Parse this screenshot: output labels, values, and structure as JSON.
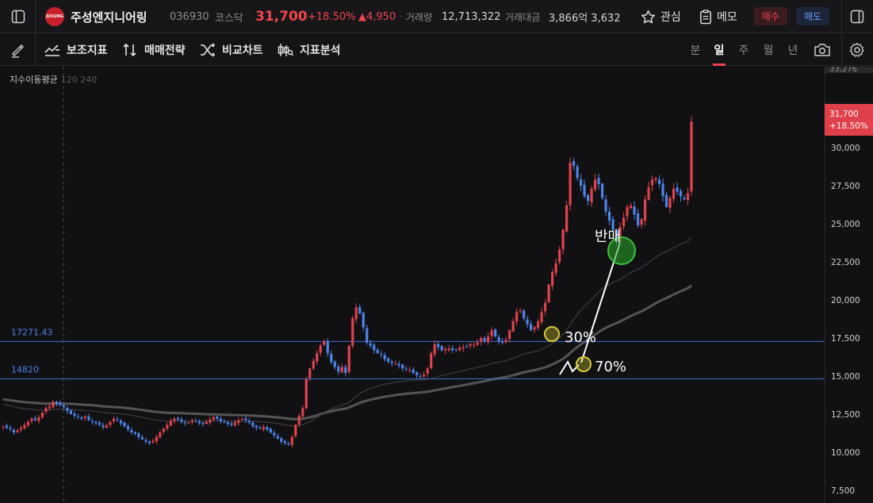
{
  "header": {
    "logo_text": "JUSUNG",
    "name": "주성엔지니어링",
    "code": "036930",
    "market": "코스닥",
    "sep": "·",
    "price": "31,700",
    "change_pct": "+18.50%",
    "change": "▲4,950",
    "volume_label": "거래량",
    "volume": "12,713,322",
    "amount_label": "거래대금",
    "amount": "3,866억 3,632",
    "watch_label": "관심",
    "memo_label": "메모",
    "buy_label": "매수",
    "sell_label": "매도"
  },
  "toolbar": {
    "tools": [
      "보조지표",
      "매매전략",
      "비교차트",
      "지표분석"
    ],
    "periods": [
      "분",
      "일",
      "주",
      "월",
      "년"
    ],
    "active_period": "일"
  },
  "chart": {
    "ma_label": "지수이동평균",
    "ma_dim": "120 240",
    "hlines": [
      {
        "value": 17271.43,
        "label": "17271.43"
      },
      {
        "value": 14820,
        "label": "14820"
      }
    ],
    "price_tag": {
      "price": "31,700",
      "pct": "+18.50%"
    },
    "top_tick": "33,276",
    "annotations": {
      "sell": "반매",
      "p30": "30%",
      "p70": "70%"
    }
  },
  "chart_data": {
    "type": "candlestick",
    "y_ticks": [
      "30,000",
      "27,500",
      "25,000",
      "22,500",
      "20,000",
      "17,500",
      "15,000",
      "12,500",
      "10,000",
      "7,500"
    ],
    "ylim": [
      7500,
      33276
    ],
    "closes": [
      11700,
      11600,
      11500,
      11300,
      11450,
      11600,
      11800,
      12000,
      12200,
      12100,
      12300,
      12600,
      12900,
      13000,
      13300,
      13200,
      13100,
      12950,
      12700,
      12500,
      12400,
      12300,
      12200,
      12350,
      12100,
      12000,
      11900,
      11800,
      11650,
      11750,
      12000,
      12200,
      12100,
      11900,
      11700,
      11500,
      11300,
      11200,
      11000,
      10850,
      10700,
      10600,
      10750,
      11000,
      11300,
      11550,
      11800,
      12050,
      12200,
      12150,
      12000,
      11900,
      11950,
      12100,
      12050,
      11900,
      11850,
      12000,
      12150,
      12300,
      12200,
      12050,
      11950,
      11850,
      11800,
      11950,
      12100,
      12200,
      12100,
      11950,
      11700,
      11600,
      11550,
      11650,
      11500,
      11300,
      11100,
      10900,
      10700,
      10600,
      10500,
      11000,
      11800,
      12400,
      12900,
      14800,
      15500,
      16000,
      16500,
      17000,
      17300,
      16500,
      15900,
      15600,
      15300,
      15600,
      15200,
      17000,
      18800,
      19500,
      19100,
      18200,
      17200,
      17000,
      16700,
      16500,
      16400,
      16100,
      15950,
      15850,
      15800,
      15700,
      15500,
      15450,
      15400,
      15200,
      15050,
      15000,
      15100,
      15500,
      16500,
      17100,
      16900,
      16700,
      16750,
      16800,
      16700,
      16750,
      16850,
      16900,
      16950,
      17100,
      17050,
      17200,
      17500,
      17300,
      17600,
      18000,
      17600,
      17300,
      17200,
      17400,
      18000,
      18600,
      19200,
      19300,
      18800,
      18400,
      18000,
      18200,
      18600,
      19200,
      19800,
      21000,
      21800,
      22400,
      23300,
      24600,
      26200,
      29000,
      28800,
      28000,
      27500,
      26800,
      26500,
      27300,
      27900,
      27600,
      26700,
      25800,
      25200,
      24600,
      23900,
      24800,
      25400,
      26100,
      26200,
      25600,
      24900,
      25300,
      26600,
      27400,
      27900,
      28000,
      27600,
      26800,
      26100,
      26700,
      27300,
      27100,
      26800,
      26600,
      27000,
      31700
    ]
  }
}
